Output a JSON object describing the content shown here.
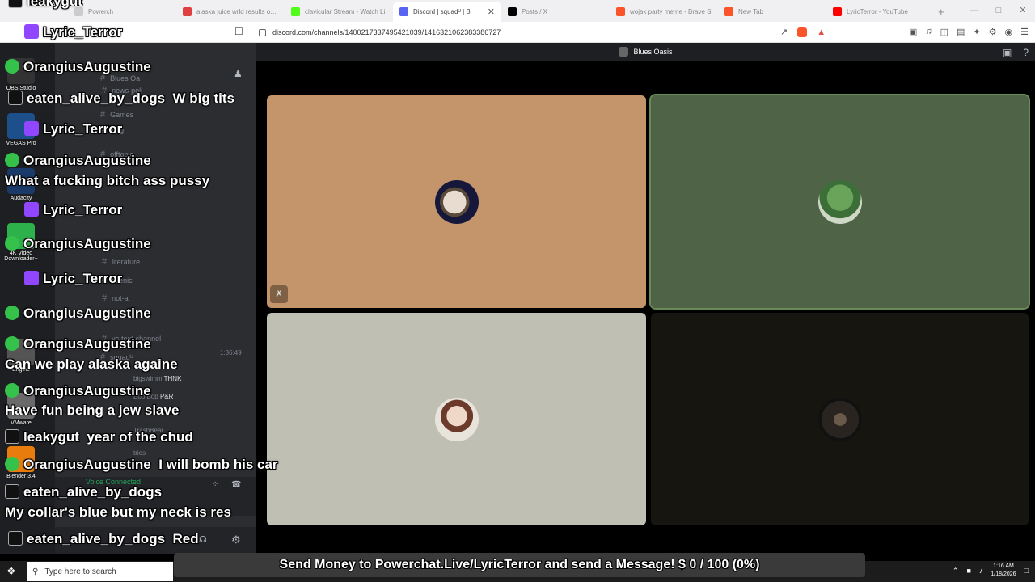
{
  "browser": {
    "tabs": [
      {
        "title": "Powerch",
        "favicon_color": "#cccccc"
      },
      {
        "title": "alaska juice wrld results on S",
        "favicon_color": "#e04040"
      },
      {
        "title": "clavicular Stream - Watch Li",
        "favicon_color": "#53fc18"
      },
      {
        "title": "Discord | squadᵁ | Bl",
        "favicon_color": "#5865f2",
        "active": true
      },
      {
        "title": "Posts / X",
        "favicon_color": "#000000"
      },
      {
        "title": "wojak party meme - Brave S",
        "favicon_color": "#fb542b"
      },
      {
        "title": "New Tab",
        "favicon_color": "#fb542b"
      },
      {
        "title": "LyricTerror - YouTube",
        "favicon_color": "#ff0000"
      }
    ],
    "url": "discord.com/channels/1400217337495421039/1416321062383386727",
    "new_tab_label": "+"
  },
  "discord": {
    "call_title": "Blues Oasis",
    "channels": [
      {
        "name": "Blues Oa"
      },
      {
        "name": "news-poli"
      },
      {
        "name": "Games"
      },
      {
        "name": "gog"
      },
      {
        "name": "offtopic"
      },
      {
        "name": "literature"
      },
      {
        "name": "scenic"
      },
      {
        "name": "not-ai"
      },
      {
        "name": "vc-text-channel"
      },
      {
        "name": "squadᵁ"
      }
    ],
    "voice_members": [
      {
        "name": "bigswimm",
        "tag": "THNK"
      },
      {
        "name": "Bop Bop",
        "tag": "P&R"
      },
      {
        "name": "TrashBear"
      },
      {
        "name": "trios"
      }
    ],
    "call_time": "1:36:49",
    "voice_status": "Voice Connected",
    "tile_colors": [
      "#c4946b",
      "#4f6446",
      "#bfc0b3",
      "#17150f"
    ]
  },
  "desktop": {
    "icons": [
      {
        "label": "OBS Studio"
      },
      {
        "label": "VEGAS Pro"
      },
      {
        "label": "Audacity"
      },
      {
        "label": "4K Video Downloader+"
      },
      {
        "label": "Engine"
      },
      {
        "label": "VMware"
      },
      {
        "label": "Blender 3.4"
      }
    ]
  },
  "chat": [
    {
      "platform": "x",
      "user": "leakygut",
      "msg": ""
    },
    {
      "platform": "purple",
      "user": "Lyric_Terror",
      "msg": ""
    },
    {
      "platform": "green",
      "user": "OrangiusAugustine",
      "msg": ""
    },
    {
      "platform": "x",
      "user": "eaten_alive_by_dogs",
      "msg": "W big tits"
    },
    {
      "platform": "purple",
      "user": "Lyric_Terror",
      "msg": ""
    },
    {
      "platform": "green",
      "user": "OrangiusAugustine",
      "msg": ""
    },
    {
      "platform": "none",
      "user": "",
      "msg": "What a fucking bitch ass pussy"
    },
    {
      "platform": "purple",
      "user": "Lyric_Terror",
      "msg": ""
    },
    {
      "platform": "green",
      "user": "OrangiusAugustine",
      "msg": ""
    },
    {
      "platform": "purple",
      "user": "Lyric_Terror",
      "msg": ""
    },
    {
      "platform": "green",
      "user": "OrangiusAugustine",
      "msg": ""
    },
    {
      "platform": "green",
      "user": "OrangiusAugustine",
      "msg": ""
    },
    {
      "platform": "none",
      "user": "",
      "msg": "Can we play alaska againe"
    },
    {
      "platform": "green",
      "user": "OrangiusAugustine",
      "msg": ""
    },
    {
      "platform": "none",
      "user": "",
      "msg": "Have fun being a jew slave"
    },
    {
      "platform": "x",
      "user": "leakygut",
      "msg": "year of the chud"
    },
    {
      "platform": "green",
      "user": "OrangiusAugustine",
      "msg": "I will bomb his car"
    },
    {
      "platform": "x",
      "user": "eaten_alive_by_dogs",
      "msg": ""
    },
    {
      "platform": "none",
      "user": "",
      "msg": "My collar's blue but my neck is res"
    },
    {
      "platform": "x",
      "user": "eaten_alive_by_dogs",
      "msg": "Red"
    }
  ],
  "banner": {
    "text": "Send Money to Powerchat.Live/LyricTerror and send a Message! $ 0 / 100 (0%)"
  },
  "taskbar": {
    "search_placeholder": "Type here to search",
    "time": "1:16 AM",
    "date": "1/18/2026"
  }
}
